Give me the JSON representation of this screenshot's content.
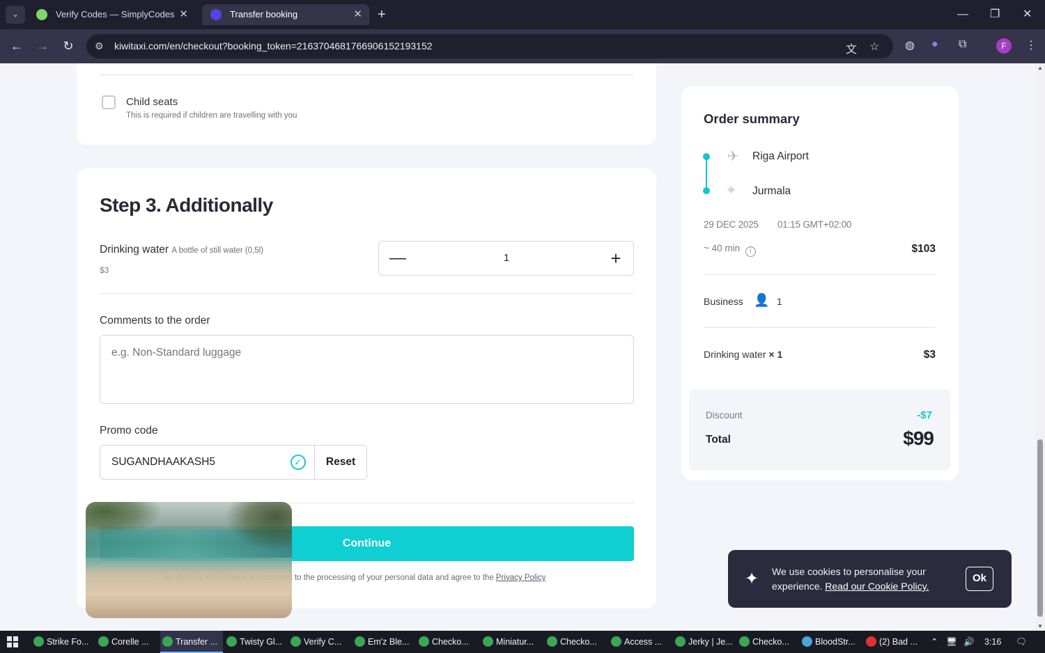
{
  "browser": {
    "tabs": [
      {
        "title": "Verify Codes — SimplyCodes",
        "favicon_color": "#7dd86a"
      },
      {
        "title": "Transfer booking",
        "favicon_color": "#4f46e5"
      }
    ],
    "url": "kiwitaxi.com/en/checkout?booking_token=216370468176690615219​3152",
    "profile_initial": "F"
  },
  "child_seats": {
    "title": "Child seats",
    "subtitle": "This is required if children are travelling with you"
  },
  "step3": {
    "title": "Step 3. Additionally",
    "water": {
      "name": "Drinking water",
      "description": "A bottle of still water (0,5l)",
      "price": "$3",
      "quantity": "1"
    },
    "comments": {
      "label": "Comments to the order",
      "placeholder": "e.g. Non-Standard luggage"
    },
    "promo": {
      "label": "Promo code",
      "value": "SUGANDHAAKASH5",
      "reset_label": "Reset"
    },
    "continue_label": "Continue",
    "consent_text": "By clicking «Continue», you consent to the processing of your personal data and agree to the",
    "privacy_link": "Privacy Policy"
  },
  "summary": {
    "title": "Order summary",
    "from": "Riga Airport",
    "to": "Jurmala",
    "date": "29 DEC 2025",
    "time": "01:15 GMT+02:00",
    "duration": "~ 40 min",
    "base_price": "$103",
    "class": "Business",
    "passengers": "1",
    "extra_label": "Drinking water",
    "extra_qty": "× 1",
    "extra_price": "$3",
    "discount_label": "Discount",
    "discount_value": "-$7",
    "total_label": "Total",
    "total_value": "$99"
  },
  "cookie": {
    "text": "We use cookies to personalise your experience.",
    "link": "Read our Cookie Policy.",
    "ok_label": "Ok"
  },
  "taskbar": {
    "items": [
      {
        "label": "Strike Fo...",
        "color": "#3aa757"
      },
      {
        "label": "Corelle ...",
        "color": "#3aa757"
      },
      {
        "label": "Transfer ...",
        "color": "#3aa757"
      },
      {
        "label": "Twisty Gl...",
        "color": "#3aa757"
      },
      {
        "label": "Verify C...",
        "color": "#3aa757"
      },
      {
        "label": "Em'z Ble...",
        "color": "#3aa757"
      },
      {
        "label": "Checko...",
        "color": "#3aa757"
      },
      {
        "label": "Miniatur...",
        "color": "#3aa757"
      },
      {
        "label": "Checko...",
        "color": "#3aa757"
      },
      {
        "label": "Access ...",
        "color": "#3aa757"
      },
      {
        "label": "Jerky | Je...",
        "color": "#3aa757"
      },
      {
        "label": "Checko...",
        "color": "#3aa757"
      },
      {
        "label": "BloodStr...",
        "color": "#4aa3df"
      },
      {
        "label": "(2) Bad ...",
        "color": "#e0312f"
      }
    ],
    "clock": "3:16"
  },
  "colors": {
    "accent": "#0fcfd2",
    "chrome_dark": "#201f2e",
    "chrome_mid": "#35344a"
  }
}
